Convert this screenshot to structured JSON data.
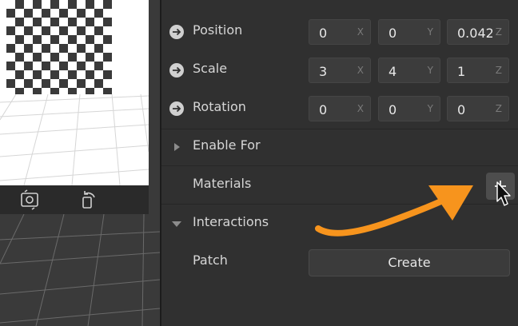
{
  "viewport": {
    "toolbar": [
      {
        "icon": "camera-switch-icon"
      },
      {
        "icon": "rotate-icon"
      }
    ]
  },
  "inspector": {
    "position": {
      "label": "Position",
      "x": "0",
      "y": "0",
      "z": "0.042",
      "axis_x": "X",
      "axis_y": "Y",
      "axis_z": "Z"
    },
    "scale": {
      "label": "Scale",
      "x": "3",
      "y": "4",
      "z": "1",
      "axis_x": "X",
      "axis_y": "Y",
      "axis_z": "Z"
    },
    "rotation": {
      "label": "Rotation",
      "x": "0",
      "y": "0",
      "z": "0",
      "axis_x": "X",
      "axis_y": "Y",
      "axis_z": "Z"
    },
    "enable_for": {
      "label": "Enable For"
    },
    "materials": {
      "label": "Materials",
      "add_label": "+"
    },
    "interactions": {
      "label": "Interactions"
    },
    "patch": {
      "label": "Patch",
      "button": "Create"
    }
  },
  "colors": {
    "annotation_arrow": "#f7941d",
    "panel_bg": "#303030"
  }
}
